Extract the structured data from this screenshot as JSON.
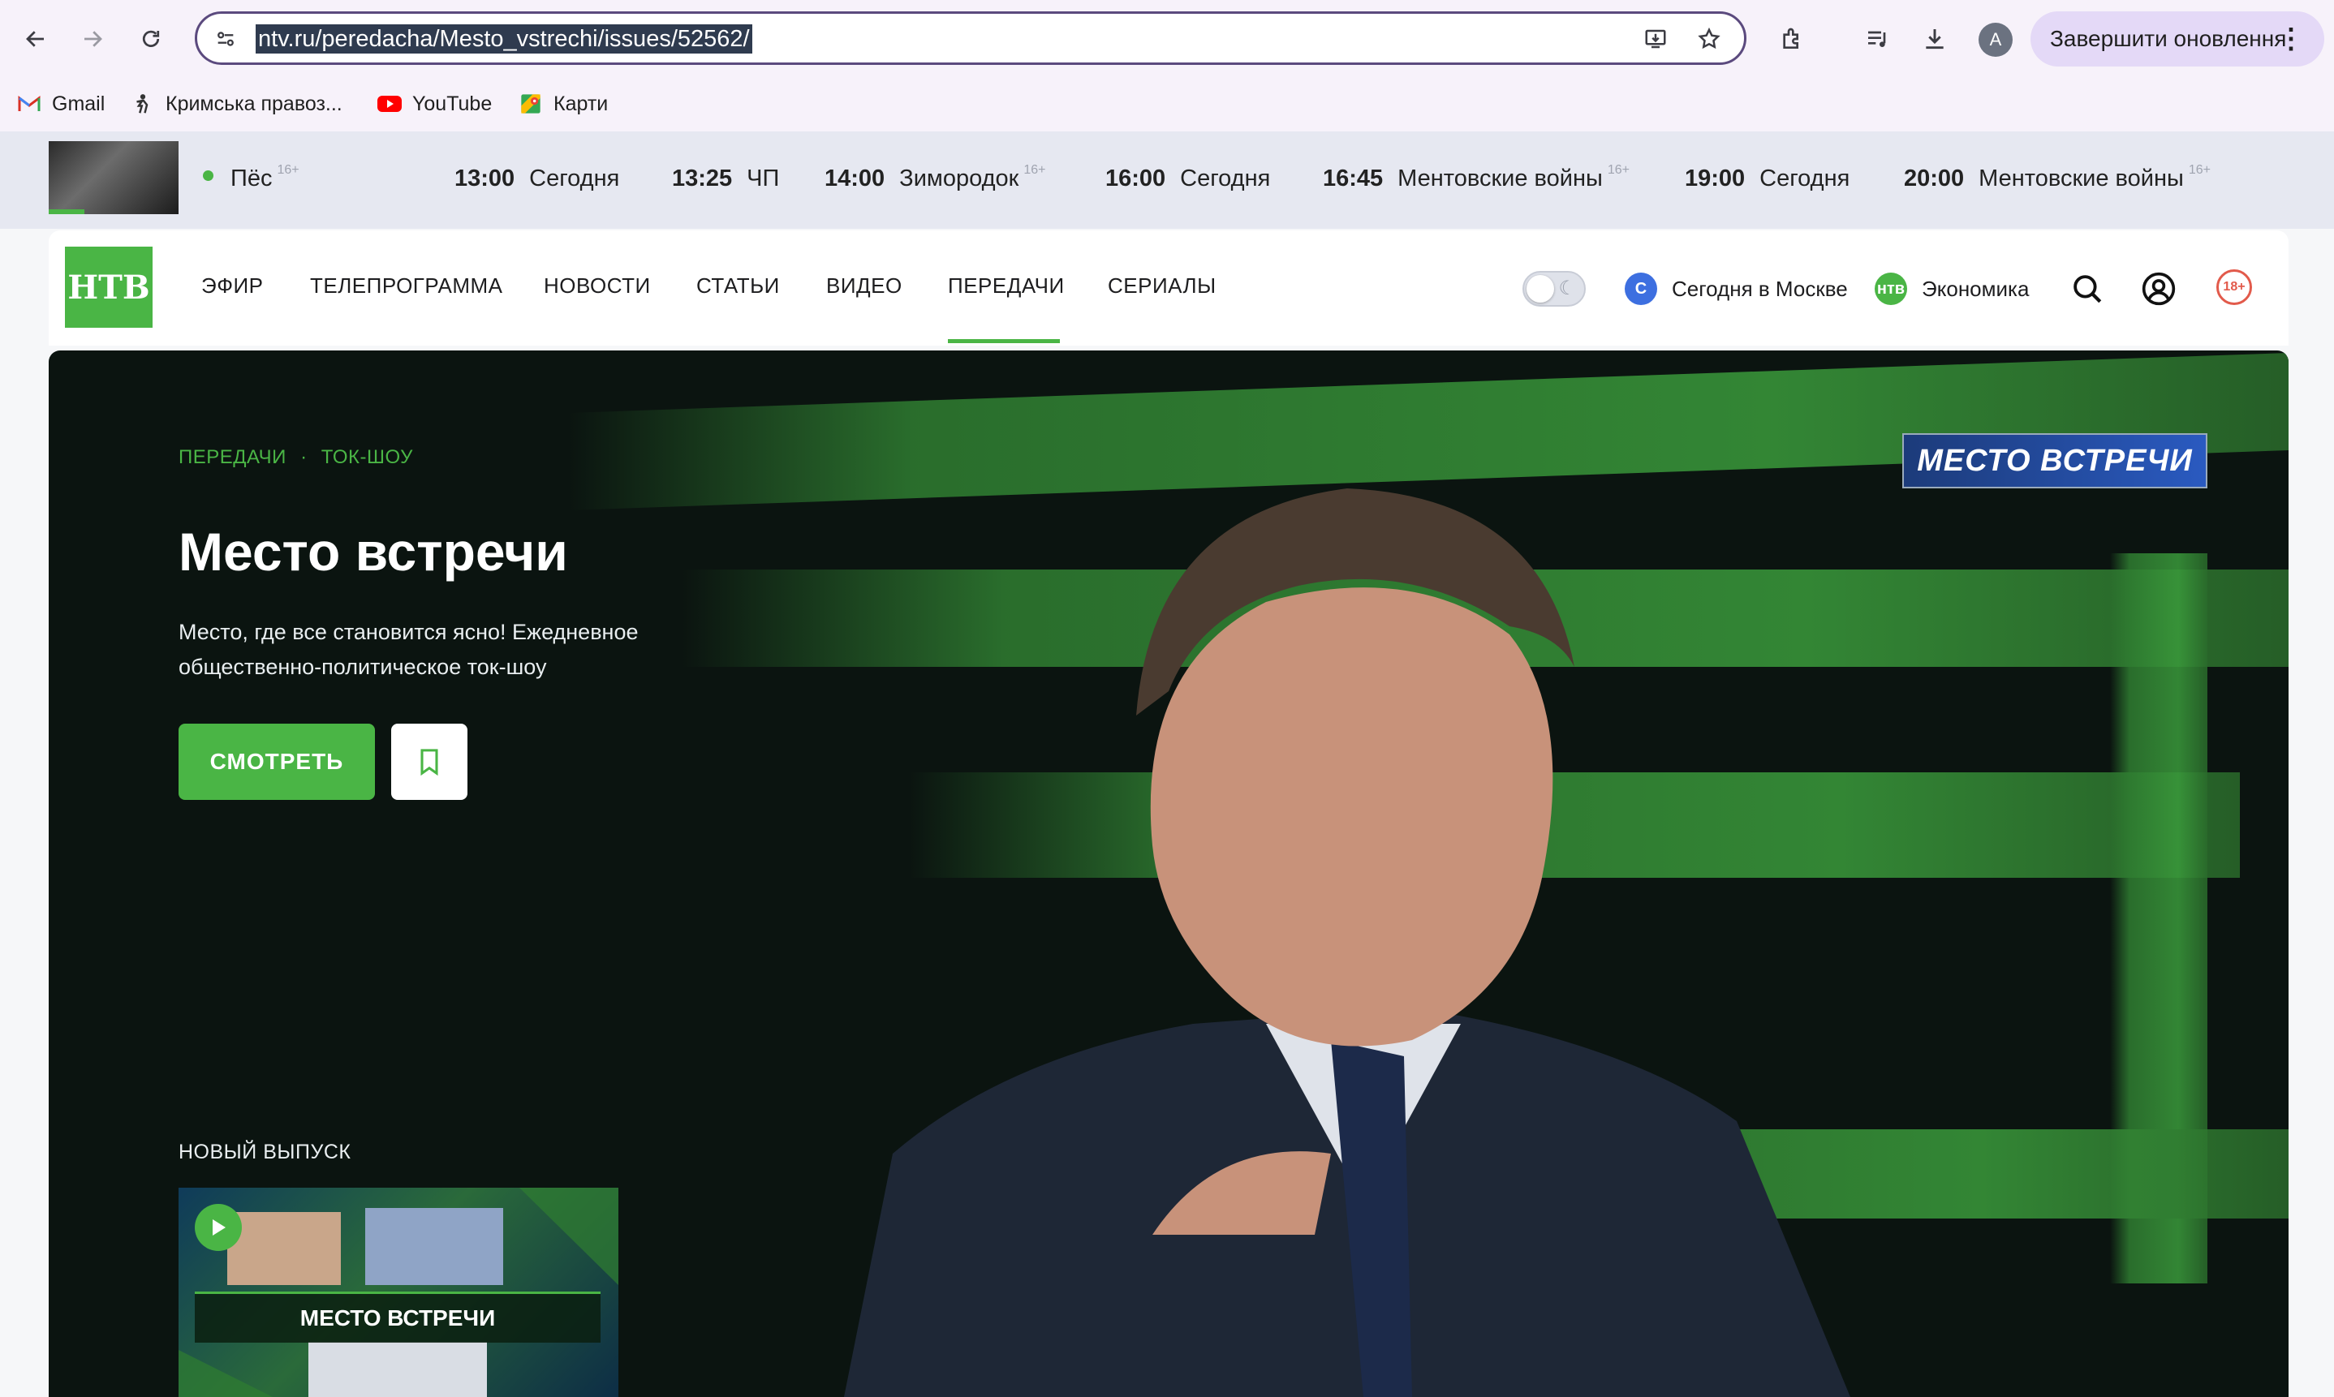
{
  "browser": {
    "url": "ntv.ru/peredacha/Mesto_vstrechi/issues/52562/",
    "avatar_letter": "A",
    "update_button": "Завершити оновлення",
    "bookmarks": [
      {
        "label": "Gmail",
        "icon": "gmail-icon"
      },
      {
        "label": "Кримська правоз...",
        "icon": "bookmark-figure-icon"
      },
      {
        "label": "YouTube",
        "icon": "youtube-icon"
      },
      {
        "label": "Карти",
        "icon": "maps-icon"
      }
    ]
  },
  "ticker": {
    "now": {
      "title": "Пёс",
      "age": "16+"
    },
    "items": [
      {
        "time": "13:00",
        "title": "Сегодня",
        "age": ""
      },
      {
        "time": "13:25",
        "title": "ЧП",
        "age": ""
      },
      {
        "time": "14:00",
        "title": "Зимородок",
        "age": "16+"
      },
      {
        "time": "16:00",
        "title": "Сегодня",
        "age": ""
      },
      {
        "time": "16:45",
        "title": "Ментовские войны",
        "age": "16+"
      },
      {
        "time": "19:00",
        "title": "Сегодня",
        "age": ""
      },
      {
        "time": "20:00",
        "title": "Ментовские войны",
        "age": "16+"
      }
    ]
  },
  "header": {
    "logo_text": "НТВ",
    "menu": [
      "ЭФИР",
      "ТЕЛЕПРОГРАММА",
      "НОВОСТИ",
      "СТАТЬИ",
      "ВИДЕО",
      "ПЕРЕДАЧИ",
      "СЕРИАЛЫ"
    ],
    "active_menu": "ПЕРЕДАЧИ",
    "channels": [
      {
        "label": "Сегодня в Москве",
        "color": "#3d6fe0"
      },
      {
        "label": "Экономика",
        "color": "#4ab545"
      }
    ],
    "age_rating": "18+"
  },
  "hero": {
    "breadcrumb": [
      "ПЕРЕДАЧИ",
      "ТОК-ШОУ"
    ],
    "title": "Место встречи",
    "description": "Место, где все становится ясно! Ежедневное общественно-политическое ток-шоу",
    "watch_label": "СМОТРЕТЬ",
    "show_logo": "МЕСТО ВСТРЕЧИ",
    "new_issue_label": "НОВЫЙ ВЫПУСК",
    "new_issue_banner": "МЕСТО ВСТРЕЧИ"
  },
  "colors": {
    "accent": "#4ab545",
    "omnibox_border": "#5b4a7e",
    "update_button_bg": "#e4d9f7"
  }
}
